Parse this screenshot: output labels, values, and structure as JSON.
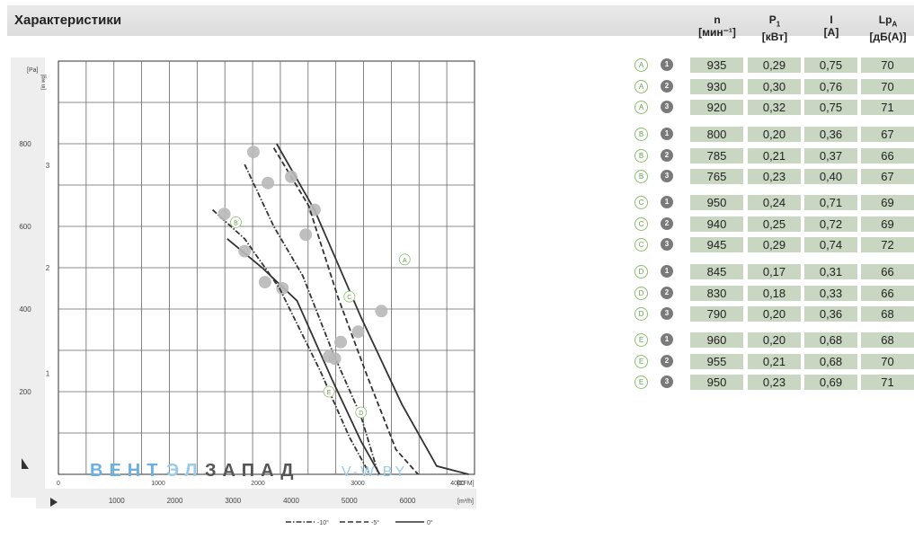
{
  "header": {
    "title": "Характеристики"
  },
  "columns": [
    {
      "name": "n",
      "sub": "",
      "unit": "[мин⁻¹]"
    },
    {
      "name": "P",
      "sub": "1",
      "unit": "[кВт]"
    },
    {
      "name": "I",
      "sub": "",
      "unit": "[A]"
    },
    {
      "name": "Lp",
      "sub": "A",
      "unit": "[дБ(A)]"
    }
  ],
  "table": [
    {
      "group": "A",
      "point": "1",
      "n": "935",
      "p1": "0,29",
      "i": "0,75",
      "lpa": "70"
    },
    {
      "group": "A",
      "point": "2",
      "n": "930",
      "p1": "0,30",
      "i": "0,76",
      "lpa": "70"
    },
    {
      "group": "A",
      "point": "3",
      "n": "920",
      "p1": "0,32",
      "i": "0,75",
      "lpa": "71"
    },
    {
      "group": "B",
      "point": "1",
      "n": "800",
      "p1": "0,20",
      "i": "0,36",
      "lpa": "67"
    },
    {
      "group": "B",
      "point": "2",
      "n": "785",
      "p1": "0,21",
      "i": "0,37",
      "lpa": "66"
    },
    {
      "group": "B",
      "point": "3",
      "n": "765",
      "p1": "0,23",
      "i": "0,40",
      "lpa": "67"
    },
    {
      "group": "C",
      "point": "1",
      "n": "950",
      "p1": "0,24",
      "i": "0,71",
      "lpa": "69"
    },
    {
      "group": "C",
      "point": "2",
      "n": "940",
      "p1": "0,25",
      "i": "0,72",
      "lpa": "69"
    },
    {
      "group": "C",
      "point": "3",
      "n": "945",
      "p1": "0,29",
      "i": "0,74",
      "lpa": "72"
    },
    {
      "group": "D",
      "point": "1",
      "n": "845",
      "p1": "0,17",
      "i": "0,31",
      "lpa": "66"
    },
    {
      "group": "D",
      "point": "2",
      "n": "830",
      "p1": "0,18",
      "i": "0,33",
      "lpa": "66"
    },
    {
      "group": "D",
      "point": "3",
      "n": "790",
      "p1": "0,20",
      "i": "0,36",
      "lpa": "68"
    },
    {
      "group": "E",
      "point": "1",
      "n": "960",
      "p1": "0,20",
      "i": "0,68",
      "lpa": "68"
    },
    {
      "group": "E",
      "point": "2",
      "n": "955",
      "p1": "0,21",
      "i": "0,68",
      "lpa": "70"
    },
    {
      "group": "E",
      "point": "3",
      "n": "950",
      "p1": "0,23",
      "i": "0,69",
      "lpa": "71"
    }
  ],
  "chart_data": {
    "type": "line",
    "title": "",
    "grid": true,
    "x_cfm": {
      "ticks": [
        "0",
        "1000",
        "2000",
        "3000",
        "4000"
      ],
      "unit": "[CFM]",
      "range": [
        0,
        4200
      ]
    },
    "x_m3h": {
      "ticks": [
        "1000",
        "2000",
        "3000",
        "4000",
        "5000",
        "6000"
      ],
      "unit": "[m³/h]",
      "range": [
        0,
        7150
      ]
    },
    "y_pa": {
      "ticks": [
        "200",
        "400",
        "600",
        "800"
      ],
      "label": "[Pa]",
      "range": [
        0,
        1000
      ]
    },
    "y_inwg": {
      "ticks": [
        "1",
        "2",
        "3"
      ],
      "label": "[in wg]"
    },
    "legend": [
      "-10°",
      "-5°",
      "0°"
    ],
    "watermark": {
      "part1": "ВЕНТ",
      "part2": "ЭЛ",
      "part3": "ЗАПАД",
      "part4": "V-W.BY"
    },
    "curve_labels": [
      "A",
      "B",
      "C",
      "D",
      "E"
    ],
    "series": [
      {
        "name": "A",
        "style": "solid",
        "color": "#333333",
        "x": [
          3750,
          4400,
          5200,
          5900,
          6500,
          7050
        ],
        "y": [
          800,
          640,
          380,
          170,
          20,
          0
        ],
        "points": [
          [
            4400,
            640
          ],
          [
            5550,
            395
          ]
        ]
      },
      {
        "name": "B",
        "style": "dash",
        "color": "#333333",
        "x": [
          3700,
          4300,
          4800,
          5300,
          5800,
          6180
        ],
        "y": [
          790,
          650,
          430,
          240,
          60,
          0
        ],
        "points": [
          [
            3350,
            780
          ],
          [
            4000,
            720
          ],
          [
            5150,
            345
          ]
        ]
      },
      {
        "name": "C",
        "style": "dashdot",
        "color": "#333333",
        "x": [
          3200,
          3700,
          4200,
          4700,
          5200,
          5500
        ],
        "y": [
          750,
          600,
          480,
          300,
          140,
          0
        ],
        "points": [
          [
            3600,
            705
          ],
          [
            4250,
            580
          ],
          [
            4850,
            320
          ]
        ]
      },
      {
        "name": "D",
        "style": "solid",
        "color": "#333333",
        "x": [
          2900,
          3500,
          4100,
          4700,
          5200,
          5520
        ],
        "y": [
          570,
          500,
          420,
          230,
          80,
          0
        ],
        "points": [
          [
            3200,
            540
          ],
          [
            3850,
            450
          ],
          [
            4750,
            280
          ]
        ]
      },
      {
        "name": "E",
        "style": "dashdot",
        "color": "#333333",
        "x": [
          2650,
          3200,
          3800,
          4500,
          5000,
          5350
        ],
        "y": [
          640,
          570,
          450,
          250,
          90,
          0
        ],
        "points": [
          [
            2850,
            630
          ],
          [
            3550,
            465
          ],
          [
            4650,
            285
          ]
        ]
      }
    ]
  }
}
